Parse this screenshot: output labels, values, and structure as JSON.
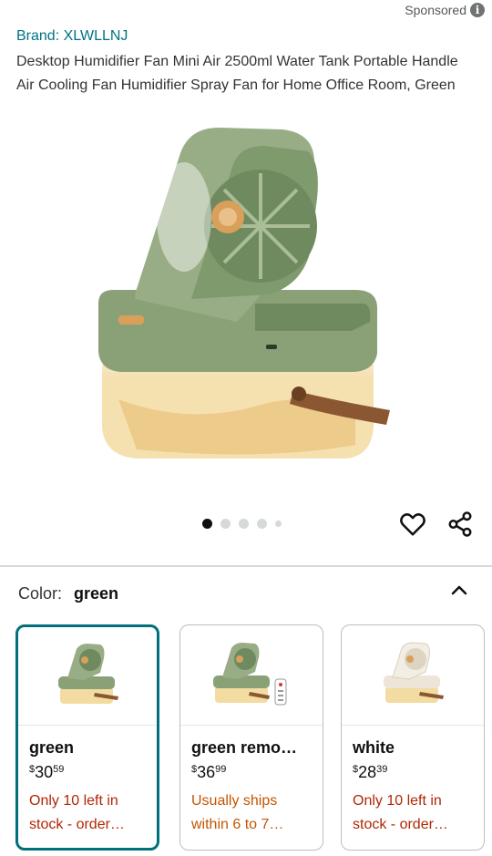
{
  "sponsored": {
    "label": "Sponsored",
    "icon": "info-icon",
    "icon_glyph": "i"
  },
  "product": {
    "brand": "Brand: XLWLLNJ",
    "title": "Desktop Humidifier Fan Mini Air 2500ml Water Tank Portable Handle Air Cooling Fan Humidifier Spray Fan for Home Office Room, Green"
  },
  "gallery": {
    "image_count": 5,
    "active_index": 0
  },
  "actions": {
    "wishlist_icon": "heart-icon",
    "share_icon": "share-icon"
  },
  "color_selector": {
    "label": "Color:",
    "selected": "green",
    "toggle_icon": "chevron-up-icon"
  },
  "variants": [
    {
      "name": "green",
      "price_symbol": "$",
      "price_whole": "30",
      "price_fraction": "59",
      "availability": "Only 10 left in stock - order…",
      "availability_color": "#b12704",
      "selected": true
    },
    {
      "name": "green remo…",
      "price_symbol": "$",
      "price_whole": "36",
      "price_fraction": "99",
      "availability": "Usually ships within 6 to 7…",
      "availability_color": "#c45500",
      "selected": false
    },
    {
      "name": "white",
      "price_symbol": "$",
      "price_whole": "28",
      "price_fraction": "39",
      "availability": "Only 10 left in stock - order…",
      "availability_color": "#b12704",
      "selected": false
    }
  ],
  "colors": {
    "link": "#007185",
    "selected_border": "#00707a",
    "fan_green": "#8aa178",
    "fan_white": "#ece5d8"
  }
}
